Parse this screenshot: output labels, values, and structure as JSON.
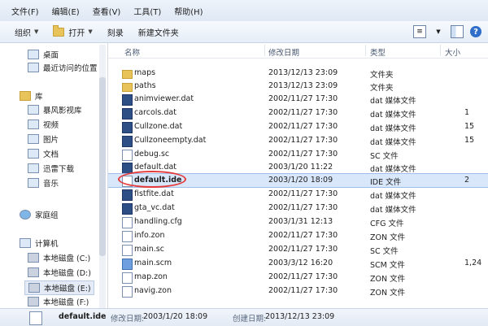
{
  "menubar": {
    "items": [
      "文件(F)",
      "编辑(E)",
      "查看(V)",
      "工具(T)",
      "帮助(H)"
    ]
  },
  "toolbar": {
    "organize": "组织",
    "open": "打开",
    "burn": "刻录",
    "new_folder": "新建文件夹"
  },
  "nav": {
    "items": [
      "桌面",
      "最近访问的位置",
      "库",
      "暴风影视库",
      "视频",
      "图片",
      "文档",
      "迅雷下载",
      "音乐",
      "家庭组",
      "计算机",
      "本地磁盘 (C:)",
      "本地磁盘 (D:)",
      "本地磁盘 (E:)",
      "本地磁盘 (F:)"
    ]
  },
  "columns": {
    "name": "名称",
    "date": "修改日期",
    "type": "类型",
    "size": "大小"
  },
  "files": [
    {
      "name": "maps",
      "date": "2013/12/13 23:09",
      "type": "文件夹",
      "size": "",
      "icon": "folder"
    },
    {
      "name": "paths",
      "date": "2013/12/13 23:09",
      "type": "文件夹",
      "size": "",
      "icon": "folder"
    },
    {
      "name": "animviewer.dat",
      "date": "2002/11/27 17:30",
      "type": "dat 媒体文件",
      "size": "",
      "icon": "dat"
    },
    {
      "name": "carcols.dat",
      "date": "2002/11/27 17:30",
      "type": "dat 媒体文件",
      "size": "1",
      "icon": "dat"
    },
    {
      "name": "Cullzone.dat",
      "date": "2002/11/27 17:30",
      "type": "dat 媒体文件",
      "size": "15",
      "icon": "dat"
    },
    {
      "name": "Cullzoneempty.dat",
      "date": "2002/11/27 17:30",
      "type": "dat 媒体文件",
      "size": "15",
      "icon": "dat"
    },
    {
      "name": "debug.sc",
      "date": "2002/11/27 17:30",
      "type": "SC 文件",
      "size": "",
      "icon": "file"
    },
    {
      "name": "default.dat",
      "date": "2003/1/20 11:22",
      "type": "dat 媒体文件",
      "size": "",
      "icon": "dat"
    },
    {
      "name": "default.ide",
      "date": "2003/1/20 18:09",
      "type": "IDE 文件",
      "size": "2",
      "icon": "file"
    },
    {
      "name": "fistfite.dat",
      "date": "2002/11/27 17:30",
      "type": "dat 媒体文件",
      "size": "",
      "icon": "dat"
    },
    {
      "name": "gta_vc.dat",
      "date": "2002/11/27 17:30",
      "type": "dat 媒体文件",
      "size": "",
      "icon": "dat"
    },
    {
      "name": "handling.cfg",
      "date": "2003/1/31 12:13",
      "type": "CFG 文件",
      "size": "",
      "icon": "file"
    },
    {
      "name": "info.zon",
      "date": "2002/11/27 17:30",
      "type": "ZON 文件",
      "size": "",
      "icon": "file"
    },
    {
      "name": "main.sc",
      "date": "2002/11/27 17:30",
      "type": "SC 文件",
      "size": "",
      "icon": "file"
    },
    {
      "name": "main.scm",
      "date": "2003/3/12 16:20",
      "type": "SCM 文件",
      "size": "1,24",
      "icon": "exe"
    },
    {
      "name": "map.zon",
      "date": "2002/11/27 17:30",
      "type": "ZON 文件",
      "size": "",
      "icon": "file"
    },
    {
      "name": "navig.zon",
      "date": "2002/11/27 17:30",
      "type": "ZON 文件",
      "size": "",
      "icon": "file"
    }
  ],
  "statusbar": {
    "filename": "default.ide",
    "modified_label": "修改日期:",
    "modified_value": "2003/1/20 18:09",
    "created_label": "创建日期:",
    "created_value": "2013/12/13 23:09"
  },
  "colors": {
    "highlight_oval": "#e53a3a",
    "selection": "#d9e7fb"
  }
}
